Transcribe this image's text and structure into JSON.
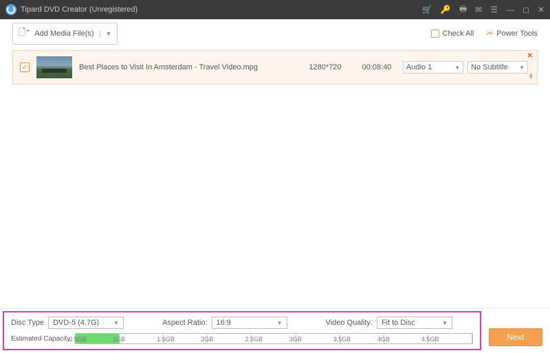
{
  "titlebar": {
    "title": "Tipard DVD Creator (Unregistered)"
  },
  "toolbar": {
    "add_label": "Add Media File(s)",
    "checkall_label": "Check All",
    "power_label": "Power Tools"
  },
  "file": {
    "name": "Best Places to Visit In Amsterdam - Travel Video.mpg",
    "resolution": "1280*720",
    "duration": "00:08:40",
    "audio_sel": "Audio 1",
    "subtitle_sel": "No Subtitle"
  },
  "settings": {
    "disc_type_label": "Disc Type",
    "disc_type_value": "DVD-5 (4.7G)",
    "aspect_label": "Aspect Ratio:",
    "aspect_value": "16:9",
    "quality_label": "Video Quality:",
    "quality_value": "Fit to Disc",
    "capacity_label": "Estimated Capacity:"
  },
  "capacity_ticks": [
    "0.5GB",
    "1GB",
    "1.5GB",
    "2GB",
    "2.5GB",
    "3GB",
    "3.5GB",
    "4GB",
    "4.5GB"
  ],
  "next_label": "Next"
}
